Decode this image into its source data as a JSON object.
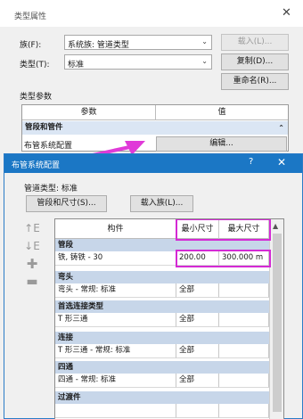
{
  "type_properties": {
    "title": "类型属性",
    "family_label": "族(F):",
    "family_value": "系统族: 管道类型",
    "load_button": "载入(L)...",
    "type_label": "类型(T):",
    "type_value": "标准",
    "duplicate_button": "复制(D)...",
    "rename_button": "重命名(R)...",
    "type_params_label": "类型参数",
    "param_header": "参数",
    "value_header": "值",
    "group_label": "管段和管件",
    "row_label": "布管系统配置",
    "edit_button": "编辑..."
  },
  "routing_dialog": {
    "title": "布管系统配置",
    "help_glyph": "?",
    "close_glyph": "✕",
    "pipe_type_label": "管道类型: 标准",
    "segments_button": "管段和尺寸(S)...",
    "load_family_button": "载入族(L)...",
    "columns": [
      "构件",
      "最小尺寸",
      "最大尺寸"
    ],
    "groups": [
      {
        "name": "管段",
        "rows": [
          {
            "part": "铁, 铸铁 - 30",
            "min": "200.00",
            "max": "300.000 m"
          }
        ]
      },
      {
        "name": "弯头",
        "rows": [
          {
            "part": "弯头 - 常规: 标准",
            "min": "全部",
            "max": ""
          }
        ]
      },
      {
        "name": "首选连接类型",
        "rows": [
          {
            "part": "T 形三通",
            "min": "全部",
            "max": ""
          }
        ]
      },
      {
        "name": "连接",
        "rows": [
          {
            "part": "T 形三通 - 常规: 标准",
            "min": "全部",
            "max": ""
          }
        ]
      },
      {
        "name": "四通",
        "rows": [
          {
            "part": "四通 - 常规: 标准",
            "min": "全部",
            "max": ""
          }
        ]
      },
      {
        "name": "过渡件",
        "rows": [
          {
            "part": "",
            "min": "",
            "max": ""
          }
        ]
      }
    ]
  },
  "icons": {
    "close": "close-icon",
    "dropdown": "chevron-down-icon",
    "collapse": "double-chevron-up-icon",
    "move_up": "move-up-icon",
    "move_down": "move-down-icon",
    "add_row": "add-row-icon",
    "remove_row": "remove-row-icon",
    "scroll_up": "scroll-up-icon"
  },
  "colors": {
    "titlebar": "#1b77c5",
    "group_fill": "#c7d6e9",
    "highlight": "#d42ad4"
  }
}
